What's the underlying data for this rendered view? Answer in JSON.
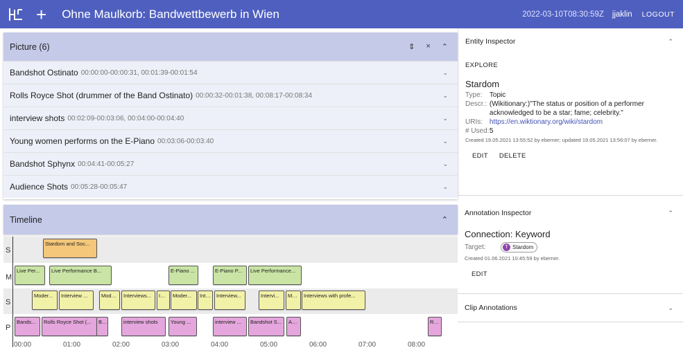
{
  "appbar": {
    "title": "Ohne Maulkorb: Bandwettbewerb in Wien",
    "timestamp": "2022-03-10T08:30:59Z",
    "user": "jjaklin",
    "logout": "LOGOUT",
    "plus": "+",
    "icons": [
      "logo-icon"
    ]
  },
  "picture": {
    "header": "Picture (6)",
    "items": [
      {
        "name": "Bandshot Ostinato",
        "time": "00:00:00-00:00:31, 00:01:39-00:01:54"
      },
      {
        "name": "Rolls Royce Shot (drummer of the Band Ostinato)",
        "time": "00:00:32-00:01:38, 00:08:17-00:08:34"
      },
      {
        "name": "interview shots",
        "time": "00:02:09-00:03:06, 00:04:00-00:04:40"
      },
      {
        "name": "Young women performs on the E-Piano",
        "time": "00:03:06-00:03:40"
      },
      {
        "name": "Bandshot Sphynx",
        "time": "00:04:41-00:05:27"
      },
      {
        "name": "Audience Shots",
        "time": "00:05:28-00:05:47"
      }
    ]
  },
  "timeline": {
    "header": "Timeline",
    "lanes": [
      {
        "label": "S",
        "segments": [
          {
            "text": "Stardom and Soc...",
            "color": "orange"
          }
        ]
      },
      {
        "label": "M",
        "segments": [
          {
            "text": "Live Per...",
            "color": "green"
          },
          {
            "text": "Live Performance B...",
            "color": "green"
          },
          {
            "text": "E-Piano ...",
            "color": "green"
          },
          {
            "text": "E-Piano P...",
            "color": "green"
          },
          {
            "text": "Live Performance...",
            "color": "green"
          }
        ]
      },
      {
        "label": "S",
        "segments": [
          {
            "text": "Moder...",
            "color": "yellow"
          },
          {
            "text": "Interview ...",
            "color": "yellow"
          },
          {
            "text": "Mode...",
            "color": "yellow"
          },
          {
            "text": "Interviews...",
            "color": "yellow"
          },
          {
            "text": "Int...",
            "color": "yellow"
          },
          {
            "text": "Moder...",
            "color": "yellow"
          },
          {
            "text": "Inte...",
            "color": "yellow"
          },
          {
            "text": "Interview...",
            "color": "yellow"
          },
          {
            "text": "Intervi...",
            "color": "yellow"
          },
          {
            "text": "Mo...",
            "color": "yellow"
          },
          {
            "text": "Interviews with profe...",
            "color": "yellow"
          }
        ]
      },
      {
        "label": "P",
        "segments": [
          {
            "text": "Bands...",
            "color": "pink"
          },
          {
            "text": "Rolls Royce Shot (...",
            "color": "pink"
          },
          {
            "text": "B...",
            "color": "pink"
          },
          {
            "text": "interview shots",
            "color": "pink"
          },
          {
            "text": "Young ...",
            "color": "pink"
          },
          {
            "text": "interview ...",
            "color": "pink"
          },
          {
            "text": "Bandshot S...",
            "color": "pink"
          },
          {
            "text": "Au...",
            "color": "pink"
          },
          {
            "text": "Ro...",
            "color": "pink"
          }
        ]
      }
    ],
    "axis": [
      "00:00",
      "01:00",
      "02:00",
      "03:00",
      "04:00",
      "05:00",
      "06:00",
      "07:00",
      "08:00"
    ]
  },
  "entity": {
    "header": "Entity Inspector",
    "explore": "EXPLORE",
    "title": "Stardom",
    "type_k": "Type:",
    "type_v": "Topic",
    "descr_k": "Descr.:",
    "descr_v": "(Wikitionary:)\"The status or position of a performer acknowledged to be a star; fame; celebrity.\"",
    "uris_k": "URIs:",
    "uris_v": "https://en.wiktionary.org/wiki/stardom",
    "used_k": "# Used:",
    "used_v": "5",
    "meta": "Created 19.05.2021 13:55:52 by eberner; updated 19.05.2021 13:56:07 by eberner.",
    "edit": "EDIT",
    "delete": "DELETE"
  },
  "annotation": {
    "header": "Annotation Inspector",
    "title": "Connection: Keyword",
    "target_k": "Target:",
    "chip_initial": "T",
    "chip_label": "Stardom",
    "meta": "Created 01.06.2021 10:45:59 by eberner.",
    "edit": "EDIT"
  },
  "clip": {
    "header": "Clip Annotations"
  },
  "colors": {
    "appbar": "#4f5fbf",
    "panel_header": "#c5cae9",
    "row_bg": "#eef0f9",
    "orange": "#f4c77a",
    "green": "#c9e4a4",
    "yellow": "#f2f1a8",
    "pink": "#e4a6dc"
  }
}
